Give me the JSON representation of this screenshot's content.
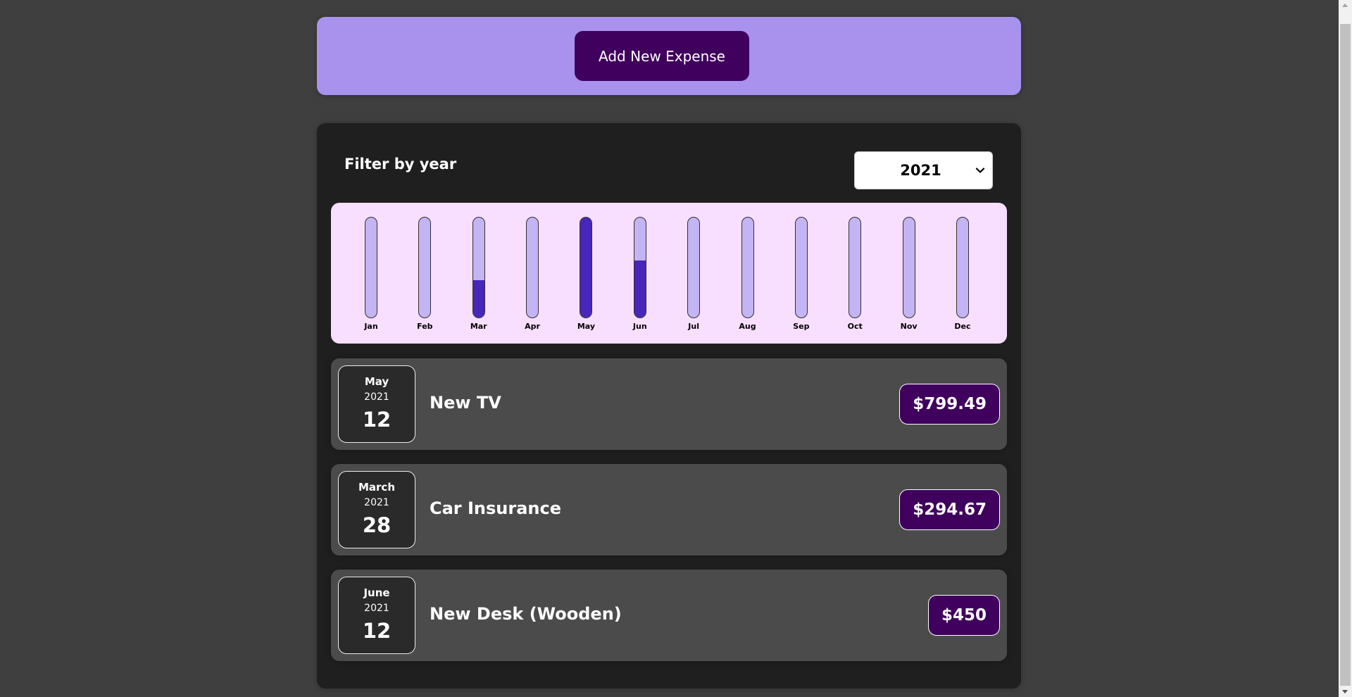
{
  "new_expense": {
    "button_label": "Add New Expense"
  },
  "filter": {
    "label": "Filter by year",
    "selected_year": "2021"
  },
  "chart_data": {
    "type": "bar",
    "categories": [
      "Jan",
      "Feb",
      "Mar",
      "Apr",
      "May",
      "Jun",
      "Jul",
      "Aug",
      "Sep",
      "Oct",
      "Nov",
      "Dec"
    ],
    "values": [
      0,
      0,
      294.67,
      0,
      799.49,
      450,
      0,
      0,
      0,
      0,
      0,
      0
    ],
    "max": 799.49
  },
  "expenses": [
    {
      "month": "May",
      "year": "2021",
      "day": "12",
      "title": "New TV",
      "amount": "$799.49"
    },
    {
      "month": "March",
      "year": "2021",
      "day": "28",
      "title": "Car Insurance",
      "amount": "$294.67"
    },
    {
      "month": "June",
      "year": "2021",
      "day": "12",
      "title": "New Desk (Wooden)",
      "amount": "$450"
    }
  ],
  "colors": {
    "page_background": "#3f3f3f",
    "header_background": "#a892ee",
    "button_background": "#40005d",
    "chart_background": "#f8dfff",
    "bar_empty": "#c3b4f3",
    "bar_fill": "#4826b9",
    "item_background": "#4b4b4b"
  }
}
